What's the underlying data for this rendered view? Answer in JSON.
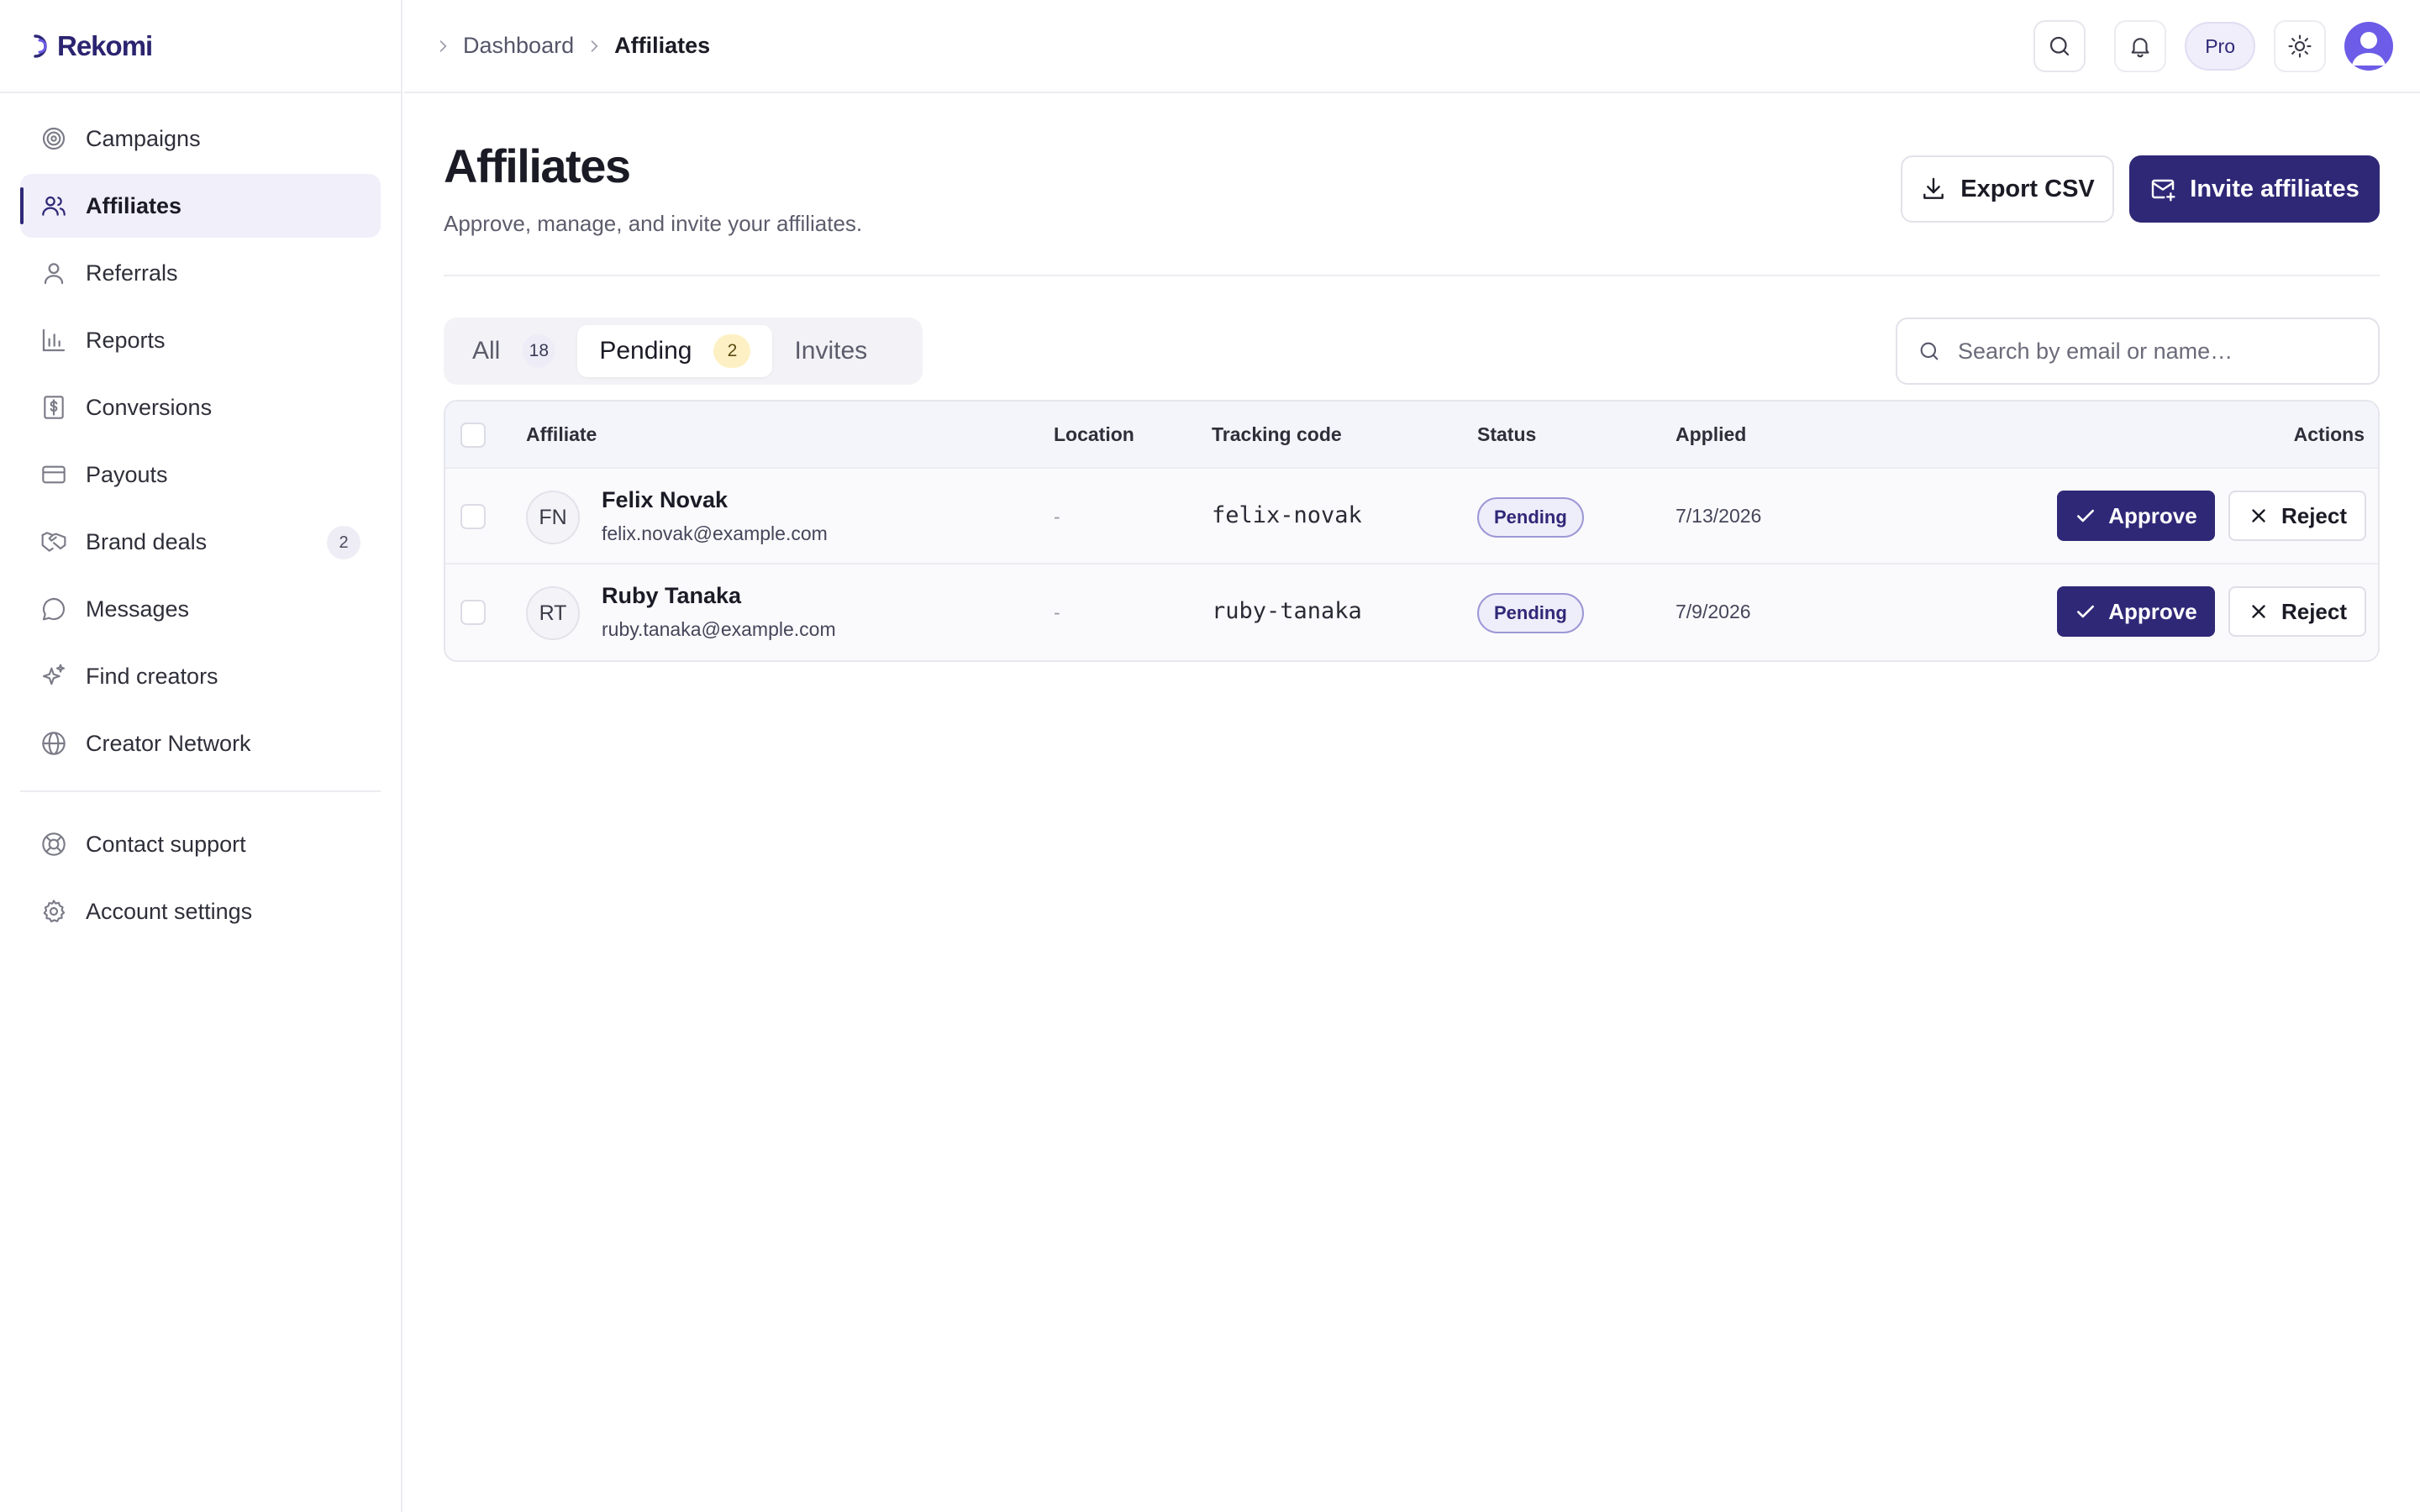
{
  "app": {
    "brand": "Rekomi",
    "accent": "#2f2877"
  },
  "sidebar": {
    "items": [
      {
        "label": "Campaigns",
        "icon": "target-icon"
      },
      {
        "label": "Affiliates",
        "icon": "users-icon",
        "active": true
      },
      {
        "label": "Referrals",
        "icon": "user-icon"
      },
      {
        "label": "Reports",
        "icon": "bar-chart-icon"
      },
      {
        "label": "Conversions",
        "icon": "receipt-dollar-icon"
      },
      {
        "label": "Payouts",
        "icon": "credit-card-icon"
      },
      {
        "label": "Brand deals",
        "icon": "handshake-icon",
        "badge": "2"
      },
      {
        "label": "Messages",
        "icon": "message-circle-icon"
      },
      {
        "label": "Find creators",
        "icon": "sparkles-icon"
      },
      {
        "label": "Creator Network",
        "icon": "globe-icon"
      }
    ],
    "footer_items": [
      {
        "label": "Contact support",
        "icon": "lifebuoy-icon"
      },
      {
        "label": "Account settings",
        "icon": "gear-icon"
      }
    ]
  },
  "topbar": {
    "breadcrumbs": [
      "Dashboard",
      "Affiliates"
    ],
    "plan_label": "Pro"
  },
  "page": {
    "title": "Affiliates",
    "subtitle": "Approve, manage, and invite your affiliates.",
    "export_label": "Export CSV",
    "invite_label": "Invite affiliates"
  },
  "tabs": [
    {
      "label": "All",
      "count": "18"
    },
    {
      "label": "Pending",
      "count": "2",
      "active": true
    },
    {
      "label": "Invites"
    }
  ],
  "search": {
    "placeholder": "Search by email or name…"
  },
  "table": {
    "columns": [
      "Affiliate",
      "Location",
      "Tracking code",
      "Status",
      "Applied",
      "Actions"
    ],
    "rows": [
      {
        "initials": "FN",
        "name": "Felix Novak",
        "email": "felix.novak@example.com",
        "location": "-",
        "tracking_code": "felix-novak",
        "status": "Pending",
        "applied": "7/13/2026"
      },
      {
        "initials": "RT",
        "name": "Ruby Tanaka",
        "email": "ruby.tanaka@example.com",
        "location": "-",
        "tracking_code": "ruby-tanaka",
        "status": "Pending",
        "applied": "7/9/2026"
      }
    ],
    "approve_label": "Approve",
    "reject_label": "Reject"
  }
}
